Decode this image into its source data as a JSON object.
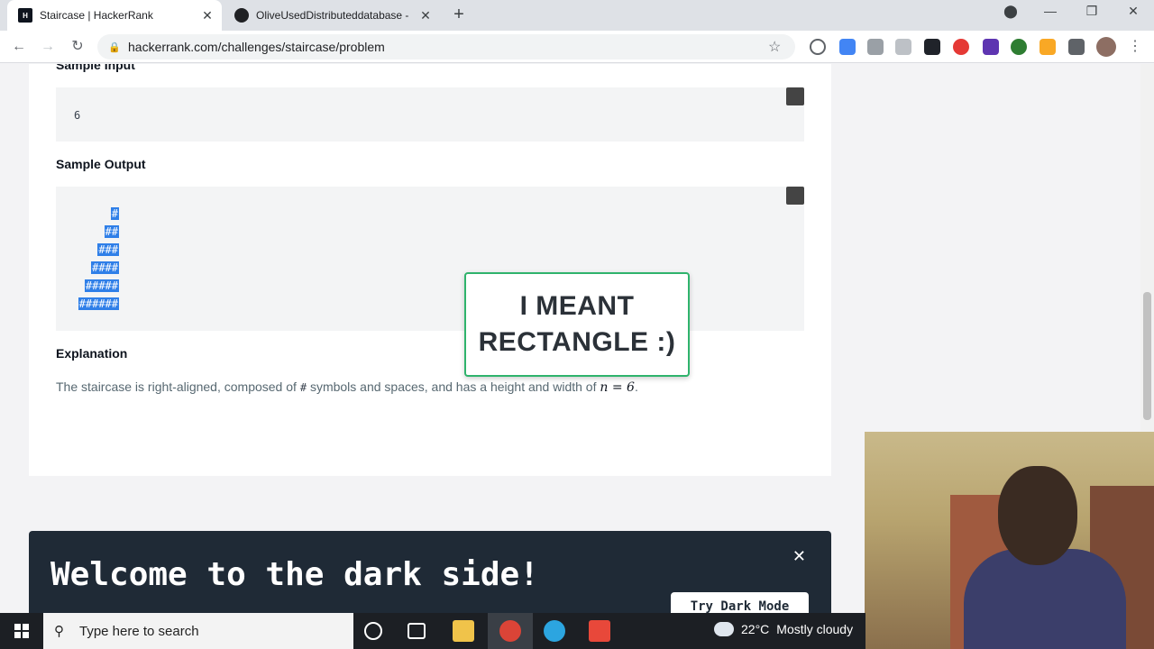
{
  "browser": {
    "tabs": [
      {
        "title": "Staircase | HackerRank",
        "favicon": "H",
        "active": true
      },
      {
        "title": "OliveUsedDistributeddatabase - ",
        "active": false
      }
    ],
    "new_tab": "+",
    "url": "hackerrank.com/challenges/staircase/problem",
    "window_controls": {
      "minimize": "—",
      "restore": "❐",
      "close": "✕"
    }
  },
  "page": {
    "sample_input_heading": "Sample Input",
    "sample_input_value": "6",
    "sample_output_heading": "Sample Output",
    "staircase_rows": [
      "#",
      "##",
      "###",
      "####",
      "#####",
      "######"
    ],
    "explanation_heading": "Explanation",
    "explanation_text_before": "The staircase is right-aligned, composed of",
    "explanation_symbol": "#",
    "explanation_text_after": "symbols and spaces, and has a height and width of",
    "explanation_math": "n = 6",
    "callout_text": "I MEANT RECTANGLE :)"
  },
  "dark_banner": {
    "title": "Welcome to the dark side!",
    "button": "Try Dark Mode",
    "close": "✕"
  },
  "taskbar": {
    "search_placeholder": "Type here to search",
    "weather_temp": "22°C",
    "weather_text": "Mostly cloudy"
  },
  "colors": {
    "hackerrank_green": "#2fb36c",
    "selection_blue": "#2f7fe8",
    "dark_banner": "#1f2a36"
  }
}
